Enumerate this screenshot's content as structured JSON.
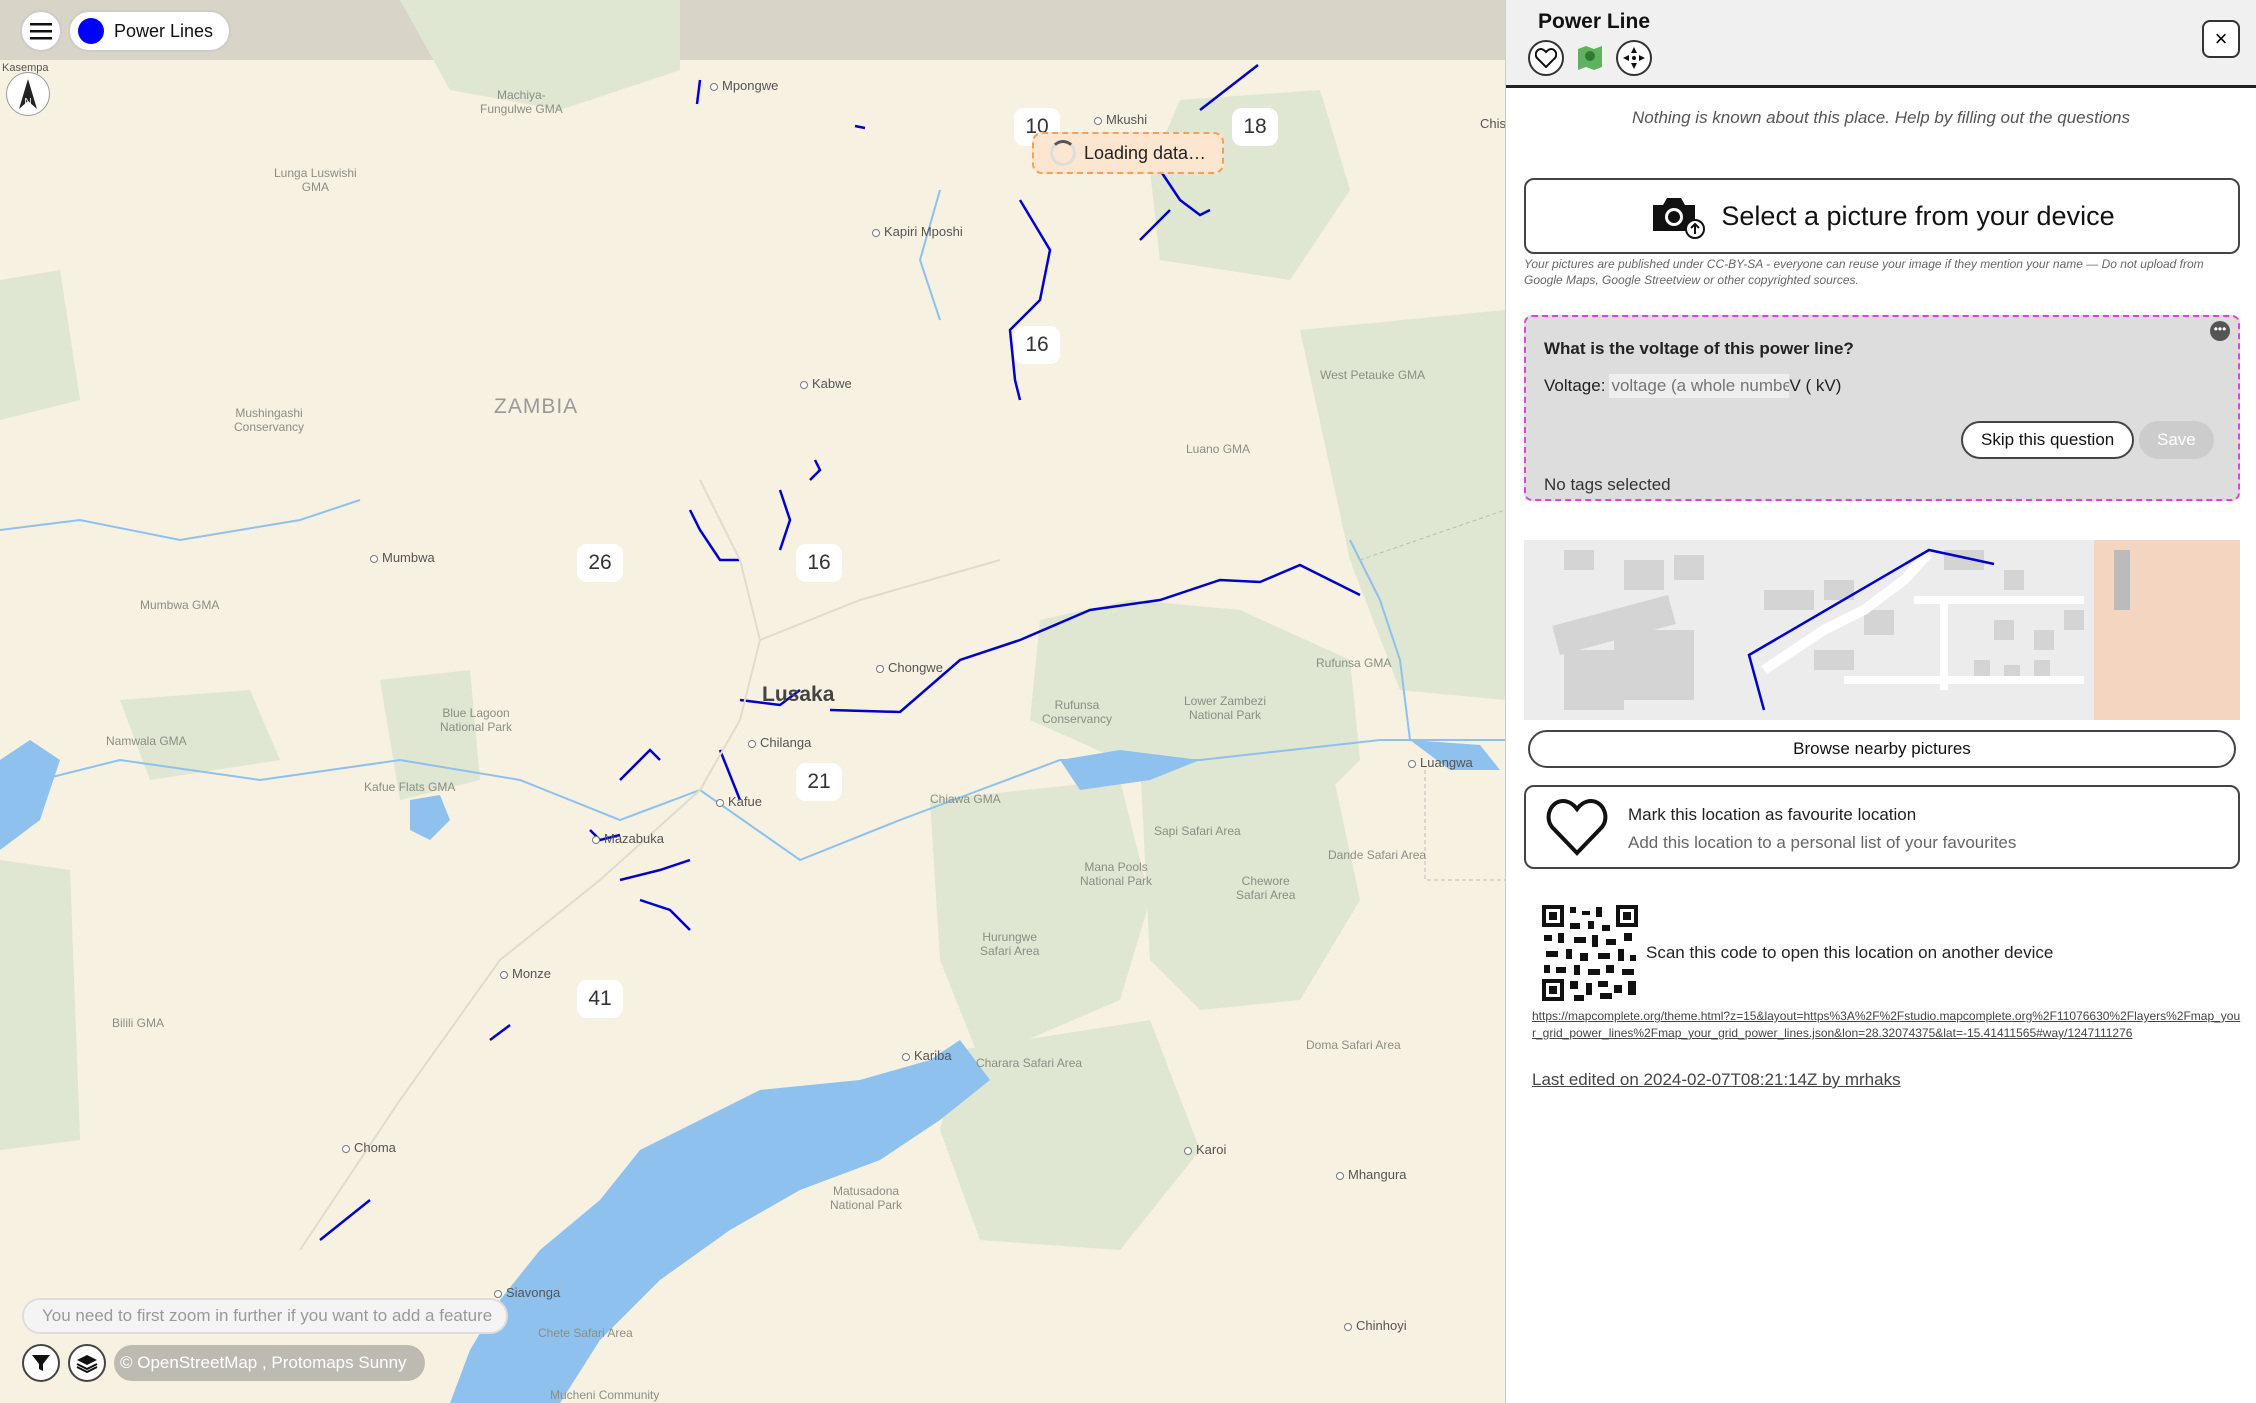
{
  "map": {
    "layer_label": "Power Lines",
    "layer_color": "#0000ff",
    "compass_label": "Kasempa",
    "loading_text": "Loading data…",
    "zoom_hint": "You need to first zoom in further if you want to add a feature",
    "attribution": "© OpenStreetMap , Protomaps Sunny",
    "country": "ZAMBIA",
    "capital": "Lusaka",
    "clusters": [
      "10",
      "18",
      "16",
      "26",
      "16",
      "21",
      "41"
    ],
    "places": {
      "mpongwe": "Mpongwe",
      "mkushi": "Mkushi",
      "kapiri": "Kapiri Mposhi",
      "kabwe": "Kabwe",
      "mumbwa": "Mumbwa",
      "chisamba": "Chisamba",
      "chongwe": "Chongwe",
      "chilanga": "Chilanga",
      "kafue": "Kafue",
      "mazabuka": "Mazabuka",
      "monze": "Monze",
      "kariba": "Kariba",
      "karoi": "Karoi",
      "choma": "Choma",
      "mhangura": "Mhangura",
      "chinhoyi": "Chinhoyi",
      "luangwa": "Luangwa",
      "siavonga": "Siavonga",
      "chi": "Chis"
    },
    "areas": {
      "machiya": "Machiya-\nFungulwe GMA",
      "lunga": "Lunga Luswishi\nGMA",
      "mushingashi": "Mushingashi\nConservancy",
      "westpetauke": "West Petauke GMA",
      "luano": "Luano GMA",
      "mumbwagma": "Mumbwa GMA",
      "rufunsa_c": "Rufunsa\nConservancy",
      "lowerzambezi": "Lower Zambezi\nNational Park",
      "rufunsagma": "Rufunsa GMA",
      "bluelagoon": "Blue Lagoon\nNational Park",
      "namwala": "Namwala GMA",
      "kafueflats": "Kafue Flats GMA",
      "chiawa": "Chiawa GMA",
      "sapi": "Sapi Safari Area",
      "dande": "Dande Safari Area",
      "manapools": "Mana Pools\nNational Park",
      "chewore": "Chewore\nSafari Area",
      "hurungwe": "Hurungwe\nSafari Area",
      "bilili": "Bilili GMA",
      "charara": "Charara Safari Area",
      "doma": "Doma Safari Area",
      "matusadona": "Matusadona\nNational Park",
      "chete": "Chete Safari Area",
      "mucheni": "Mucheni Community"
    }
  },
  "panel": {
    "title": "Power Line",
    "close": "×",
    "nothing_known": "Nothing is known about this place. Help by filling out the questions",
    "upload_label": "Select a picture from your device",
    "license_text": "Your pictures are published under CC-BY-SA - everyone can reuse your image if they mention your name  —  Do not upload from Google Maps, Google Streetview or other copyrighted sources.",
    "question": {
      "title": "What is the voltage of this power line?",
      "field_label": "Voltage:",
      "placeholder": "voltage (a whole number)",
      "unit": "V ( kV)",
      "skip": "Skip this question",
      "save": "Save",
      "no_tags": "No tags selected"
    },
    "browse_label": "Browse nearby pictures",
    "favourite": {
      "title": "Mark this location as favourite location",
      "subtitle": "Add this location to a personal list of your favourites"
    },
    "qr_text": "Scan this code to open this location on another device",
    "qr_url": "https://mapcomplete.org/theme.html?z=15&layout=https%3A%2F%2Fstudio.mapcomplete.org%2F11076630%2Flayers%2Fmap_your_grid_power_lines%2Fmap_your_grid_power_lines.json&lon=28.32074375&lat=-15.41411565#way/1247111276",
    "last_edited": "Last edited on 2024-02-07T08:21:14Z by mrhaks"
  }
}
